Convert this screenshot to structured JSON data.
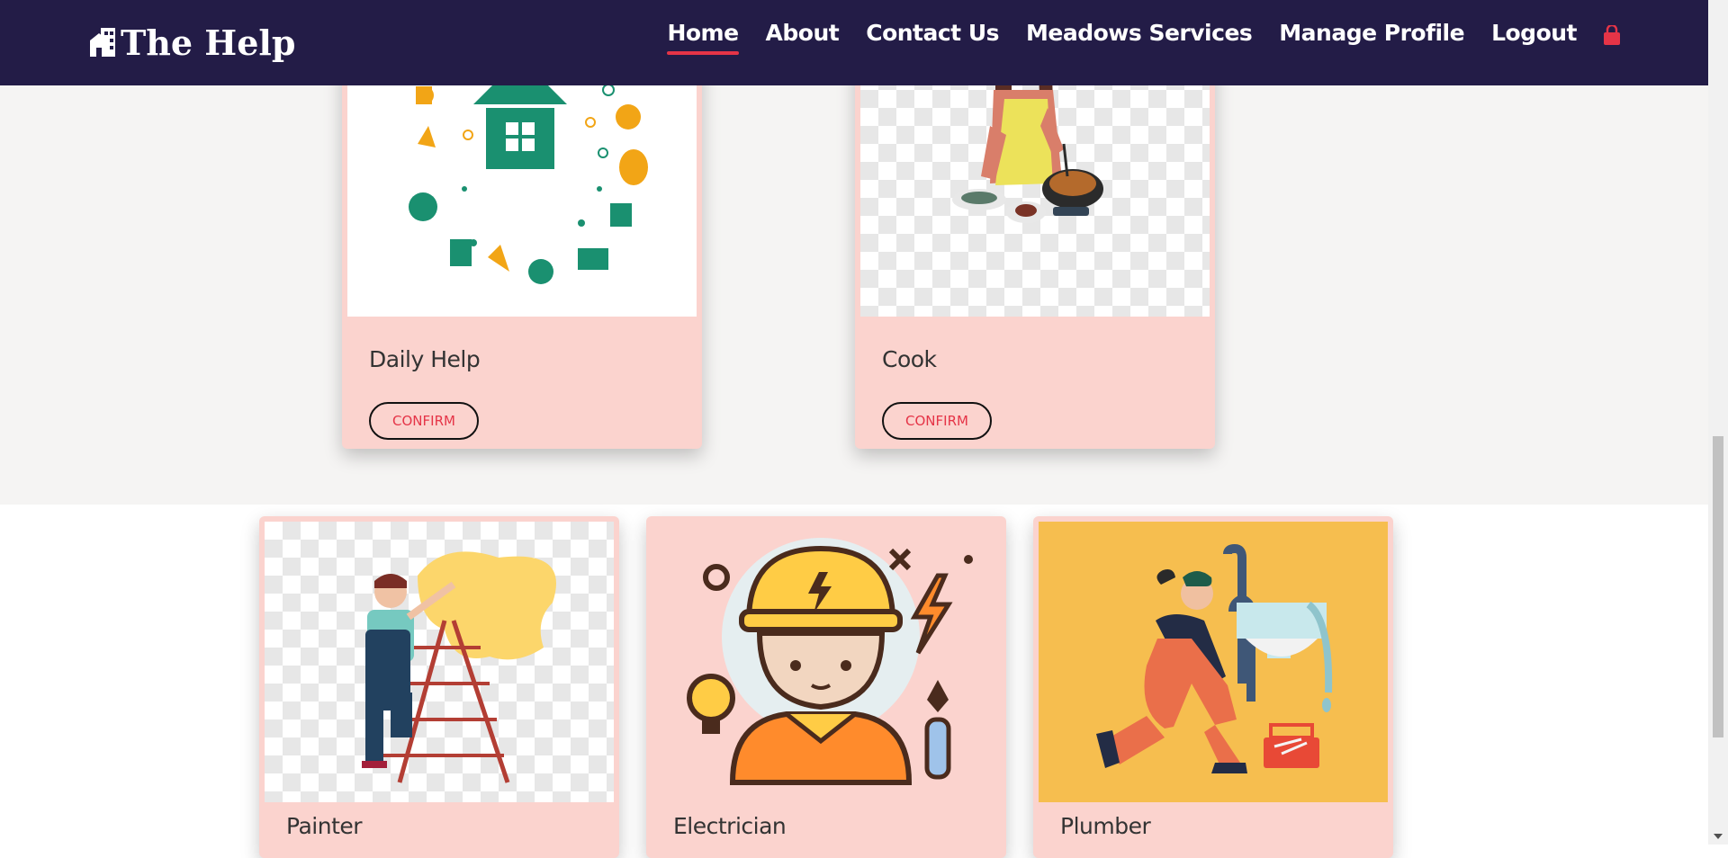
{
  "brand": {
    "name": "The Help",
    "icon": "building-icon"
  },
  "nav": {
    "items": [
      {
        "label": "Home",
        "active": true
      },
      {
        "label": "About",
        "active": false
      },
      {
        "label": "Contact Us",
        "active": false
      },
      {
        "label": "Meadows Services",
        "active": false
      },
      {
        "label": "Manage Profile",
        "active": false
      },
      {
        "label": "Logout",
        "active": false
      }
    ],
    "cart_icon": "shopping-bag-icon"
  },
  "services_top": [
    {
      "title": "Daily Help",
      "button": "CONFIRM",
      "image": "cleaning-house-illustration"
    },
    {
      "title": "Cook",
      "button": "CONFIRM",
      "image": "woman-cooking-illustration"
    }
  ],
  "services_bottom": [
    {
      "title": "Painter",
      "image": "painter-on-ladder-illustration"
    },
    {
      "title": "Electrician",
      "image": "electrician-illustration"
    },
    {
      "title": "Plumber",
      "image": "plumber-illustration"
    }
  ],
  "colors": {
    "navbar": "#231c47",
    "accent": "#e53447",
    "card": "#fbd3ce",
    "section_grey": "#f5f4f3"
  }
}
